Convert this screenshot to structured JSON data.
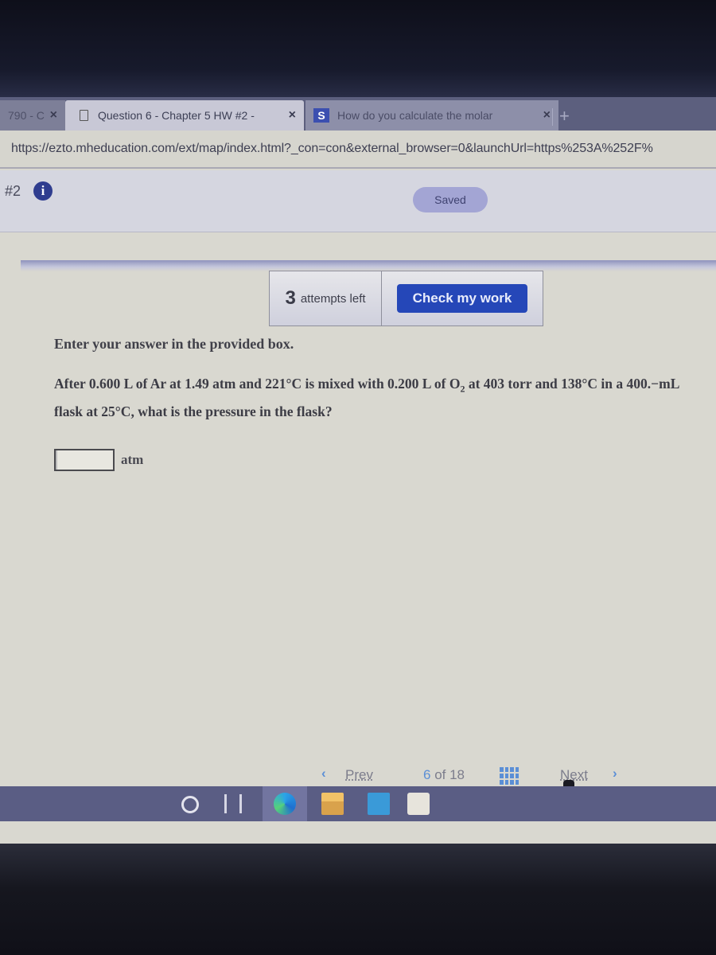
{
  "browser": {
    "tabs": [
      {
        "label": "790 - C",
        "state": "inactive"
      },
      {
        "label": "Question 6 - Chapter 5 HW #2 -",
        "state": "active"
      },
      {
        "label": "How do you calculate the molar",
        "state": "inactive",
        "favicon": "S"
      }
    ],
    "new_tab_label": "+",
    "close_label": "×",
    "url": "https://ezto.mheducation.com/ext/map/index.html?_con=con&external_browser=0&launchUrl=https%253A%252F%"
  },
  "header": {
    "question_number": "#2",
    "info_icon": "i",
    "saved_label": "Saved"
  },
  "attempts": {
    "count": "3",
    "label": "attempts left",
    "check_label": "Check my work"
  },
  "question": {
    "instruction": "Enter your answer in the provided box.",
    "text_part1": "After 0.600 L of Ar at 1.49 atm and 221°C is mixed with 0.200 L of O",
    "subscript": "2",
    "text_part2": " at 403 torr and 138°C in a 400.−mL flask at 25°C, what is the pressure in the flask?",
    "answer_value": "",
    "answer_unit": "atm"
  },
  "pagination": {
    "prev_icon": "‹",
    "prev_label": "Prev",
    "current": "6",
    "of_label": "of 18",
    "next_label": "Next",
    "next_icon": "›"
  },
  "taskbar": {
    "icons": [
      "search-icon",
      "task-view-icon",
      "edge-icon",
      "file-explorer-icon",
      "mail-icon",
      "store-icon"
    ]
  },
  "colors": {
    "accent": "#2547b8",
    "saved_pill": "#a3a5d4",
    "info_icon": "#2f3d8f",
    "pager_accent": "#5b8fd6"
  }
}
